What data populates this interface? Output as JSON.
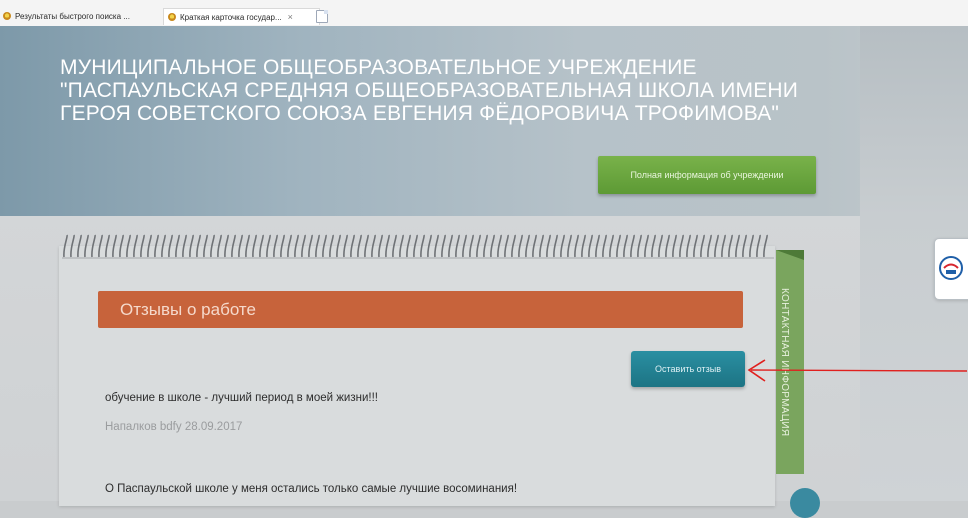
{
  "browser": {
    "tabs": [
      {
        "label": "Результаты быстрого поиска ..."
      },
      {
        "label": "Краткая карточка государ...",
        "close": "×"
      }
    ]
  },
  "header": {
    "title_lines": [
      "МУНИЦИПАЛЬНОЕ ОБЩЕОБРАЗОВАТЕЛЬНОЕ УЧРЕЖДЕНИЕ",
      "\"ПАСПАУЛЬСКАЯ СРЕДНЯЯ ОБЩЕОБРАЗОВАТЕЛЬНАЯ ШКОЛА ИМЕНИ",
      "ГЕРОЯ СОВЕТСКОГО СОЮЗА ЕВГЕНИЯ ФЁДОРОВИЧА ТРОФИМОВА\""
    ],
    "full_info_button": "Полная информация об учреждении"
  },
  "reviews": {
    "title": "Отзывы о работе",
    "leave_review_button": "Оставить отзыв",
    "items": [
      {
        "text": "обучение в школе - лучший период в моей жизни!!!",
        "author_date": "Напалков bdfy 28.09.2017"
      },
      {
        "text": "О Паспаульской школе у меня остались только самые лучшие восоминания!"
      }
    ]
  },
  "sidebar": {
    "contact_tab": "КОНТАКТНАЯ ИНФОРМАЦИЯ"
  },
  "colors": {
    "accent_green": "#5d9a35",
    "review_header": "#c7633b",
    "button_teal": "#1d7484",
    "annotation_arrow": "#e0201e"
  },
  "icons": {
    "tab_favicon": "gold-emblem-icon",
    "new_tab": "new-tab-icon",
    "widget": "feedback-widget-icon",
    "arrow": "red-arrow-annotation"
  }
}
